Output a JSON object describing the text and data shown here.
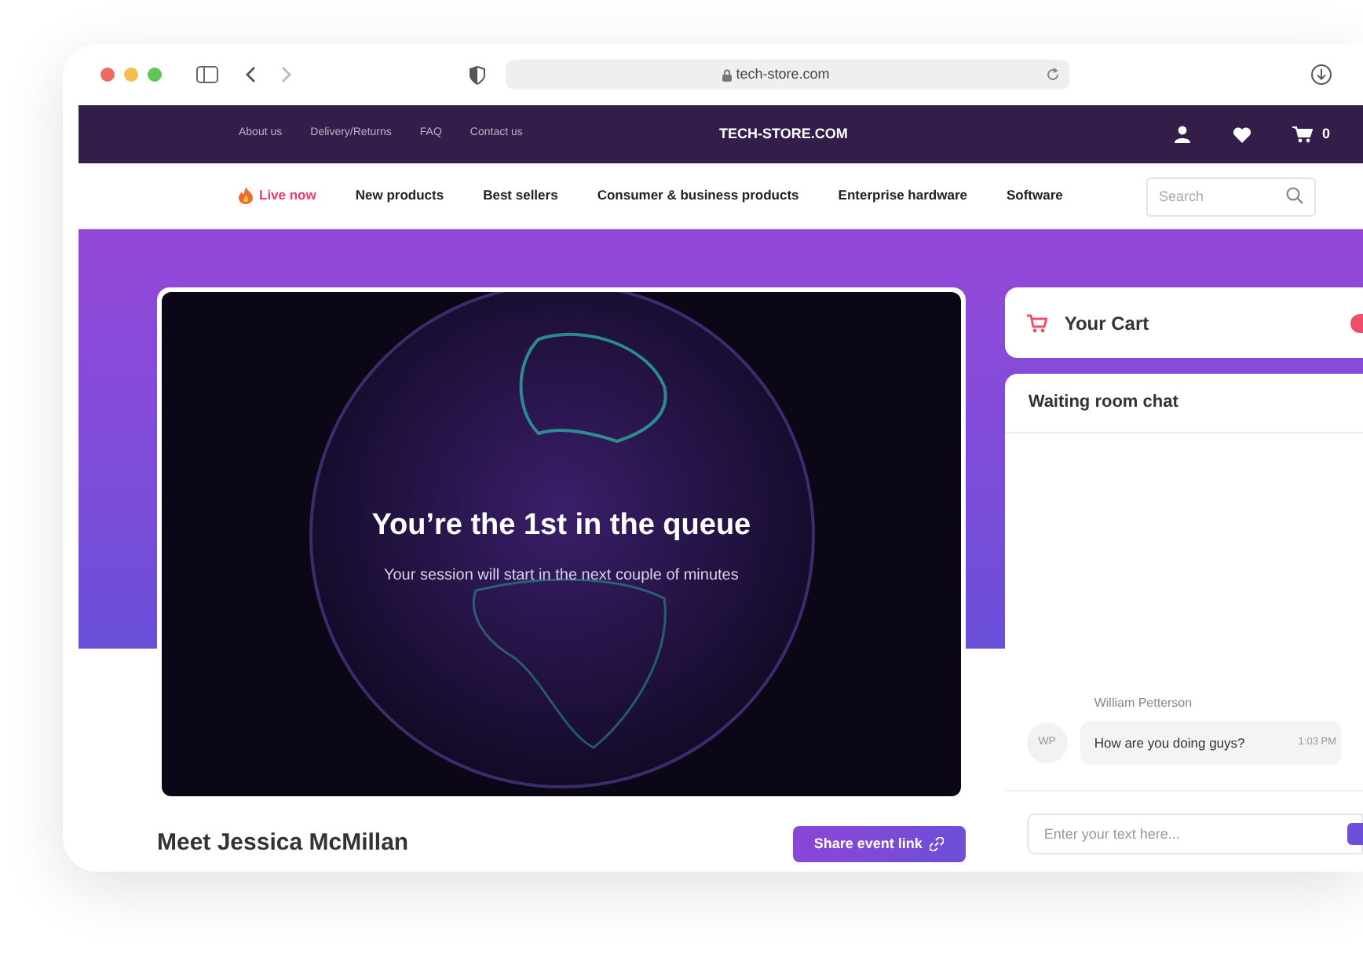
{
  "browser": {
    "url": "tech-store.com"
  },
  "top_bar": {
    "links": [
      "About us",
      "Delivery/Returns",
      "FAQ",
      "Contact us"
    ],
    "logo": "TECH-STORE.COM",
    "cart_count": "0"
  },
  "nav": {
    "items": [
      {
        "label": "Live now",
        "kind": "live"
      },
      {
        "label": "New products",
        "kind": "link"
      },
      {
        "label": "Best sellers",
        "kind": "link"
      },
      {
        "label": "Consumer & business products",
        "kind": "link"
      },
      {
        "label": "Enterprise hardware",
        "kind": "link"
      },
      {
        "label": "Software",
        "kind": "link"
      }
    ],
    "search": {
      "placeholder": "Search"
    }
  },
  "video": {
    "title": "You’re the 1st in the queue",
    "subtitle": "Your session will start in the next couple of minutes"
  },
  "host": {
    "title": "Meet Jessica McMillan",
    "share_button": "Share event link"
  },
  "cart": {
    "title": "Your Cart"
  },
  "chat": {
    "title": "Waiting room chat",
    "messages": [
      {
        "author": "William Petterson",
        "initials": "WP",
        "text": "How are you doing guys?",
        "time": "1:03 PM"
      }
    ],
    "input": {
      "placeholder": "Enter your text here..."
    }
  }
}
